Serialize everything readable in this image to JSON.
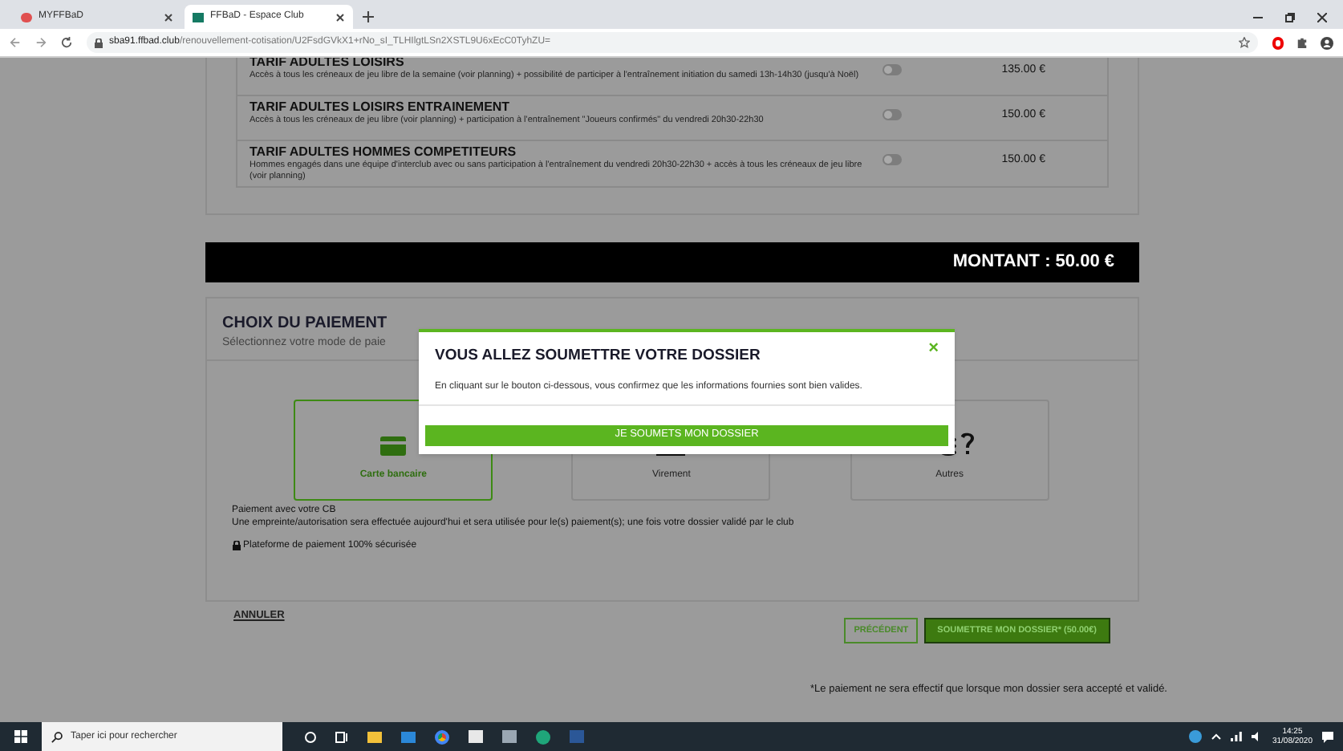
{
  "browser": {
    "tabs": [
      {
        "title": "MYFFBaD",
        "selected": false
      },
      {
        "title": "FFBaD - Espace Club",
        "selected": true
      }
    ],
    "url_host": "sba91.ffbad.club",
    "url_path": "/renouvellement-cotisation/U2FsdGVkX1+rNo_sI_TLHIlgtLSn2XSTL9U6xEcC0TyhZU="
  },
  "tarifs": [
    {
      "title": "TARIF ADULTES LOISIRS",
      "description": "Accès à tous les créneaux de jeu libre de la semaine (voir planning) + possibilité de participer à l'entraînement initiation du samedi 13h-14h30 (jusqu'à Noël)",
      "on": false,
      "price": "135.00 €"
    },
    {
      "title": "TARIF ADULTES LOISIRS ENTRAINEMENT",
      "description": "Accès à tous les créneaux de jeu libre (voir planning) + participation à l'entraînement \"Joueurs confirmés\" du vendredi 20h30-22h30",
      "on": false,
      "price": "150.00 €"
    },
    {
      "title": "TARIF ADULTES HOMMES COMPETITEURS",
      "description": "Hommes engagés dans une équipe d'interclub avec ou sans participation à l'entraînement du vendredi 20h30-22h30 + accès à tous les créneaux de jeu libre (voir planning)",
      "on": false,
      "price": "150.00 €"
    }
  ],
  "montant": "MONTANT : 50.00 €",
  "payment": {
    "title": "CHOIX DU PAIEMENT",
    "subtitle": "Sélectionnez votre mode de paie",
    "methods": [
      {
        "kind": "card",
        "label": "Carte bancaire",
        "selected": true
      },
      {
        "kind": "transfer",
        "label": "Virement",
        "selected": false
      },
      {
        "kind": "other",
        "label": "Autres",
        "selected": false
      }
    ],
    "info": [
      "Paiement avec votre CB",
      "Une empreinte/autorisation sera effectuée aujourd'hui et sera utilisée pour le(s) paiement(s); une fois votre dossier validé par le club"
    ],
    "secure": "Plateforme de paiement 100% sécurisée"
  },
  "cancel": "ANNULER",
  "previous": "PRÉCÉDENT",
  "submit": "SOUMETTRE MON DOSSIER* (50.00€)",
  "footnote": "*Le paiement ne sera effectif que lorsque mon dossier sera accepté et validé.",
  "modal": {
    "title": "VOUS ALLEZ SOUMETTRE VOTRE DOSSIER",
    "close": "×",
    "text": "En cliquant sur le bouton ci-dessous, vous confirmez que les informations fournies sont bien valides.",
    "button": "JE SOUMETS MON DOSSIER"
  },
  "taskbar": {
    "search_placeholder": "Taper ici pour rechercher",
    "time": "14:25",
    "date": "31/08/2020"
  }
}
